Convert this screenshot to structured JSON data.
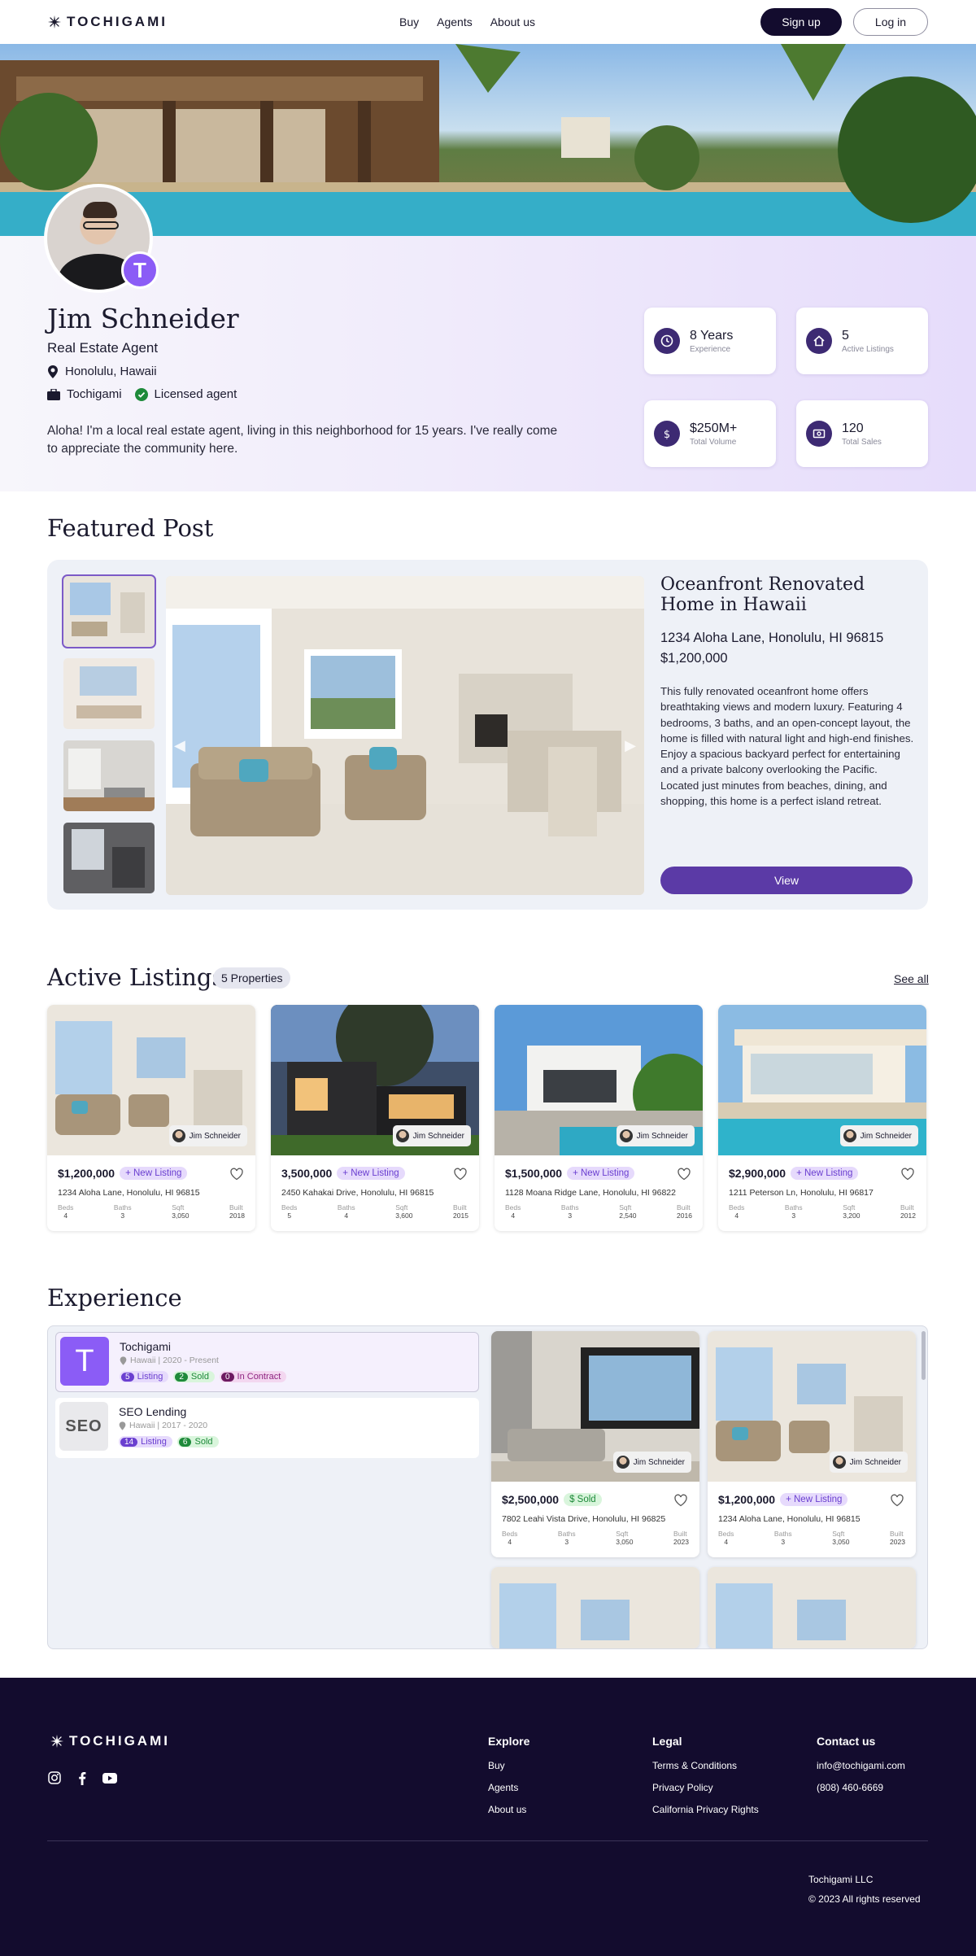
{
  "brand": {
    "name": "TOCHIGAMI"
  },
  "nav": {
    "links": [
      "Buy",
      "Agents",
      "About us"
    ],
    "signup": "Sign up",
    "login": "Log in"
  },
  "profile": {
    "name": "Jim Schneider",
    "role": "Real Estate Agent",
    "location": "Honolulu, Hawaii",
    "company": "Tochigami",
    "license": "Licensed agent",
    "bio": "Aloha! I'm a local real estate agent, living in this neighborhood for 15 years. I've really come to appreciate the community here.",
    "badge_letter": "T",
    "stats": [
      {
        "value": "8 Years",
        "label": "Experience",
        "icon": "clock-icon"
      },
      {
        "value": "5",
        "label": "Active Listings",
        "icon": "home-icon"
      },
      {
        "value": "$250M+",
        "label": "Total Volume",
        "icon": "dollar-icon"
      },
      {
        "value": "120",
        "label": "Total Sales",
        "icon": "cash-icon"
      }
    ]
  },
  "featured": {
    "heading": "Featured Post",
    "title": "Oceanfront Renovated Home in Hawaii",
    "address": "1234 Aloha Lane, Honolulu, HI 96815",
    "price": "$1,200,000",
    "description": "This fully renovated oceanfront home offers breathtaking views and modern luxury. Featuring 4 bedrooms, 3 baths, and an open-concept layout, the home is filled with natural light and high-end finishes. Enjoy a spacious backyard perfect for entertaining and a private balcony overlooking the Pacific. Located just minutes from beaches, dining, and shopping, this home is a perfect island retreat.",
    "view_label": "View"
  },
  "listings": {
    "heading": "Active Listings",
    "count": "5 Properties",
    "see_all": "See all",
    "spec_labels": {
      "beds": "Beds",
      "baths": "Baths",
      "sqft": "Sqft",
      "built": "Built"
    },
    "items": [
      {
        "price": "$1,200,000",
        "tag": "+ New Listing",
        "address": "1234 Aloha Lane, Honolulu, HI 96815",
        "beds": "4",
        "baths": "3",
        "sqft": "3,050",
        "built": "2018",
        "agent": "Jim Schneider"
      },
      {
        "price": "3,500,000",
        "tag": "+ New Listing",
        "address": "2450 Kahakai Drive, Honolulu, HI 96815",
        "beds": "5",
        "baths": "4",
        "sqft": "3,600",
        "built": "2015",
        "agent": "Jim Schneider"
      },
      {
        "price": "$1,500,000",
        "tag": "+ New Listing",
        "address": "1128 Moana Ridge Lane, Honolulu, HI 96822",
        "beds": "4",
        "baths": "3",
        "sqft": "2,540",
        "built": "2016",
        "agent": "Jim Schneider"
      },
      {
        "price": "$2,900,000",
        "tag": "+ New Listing",
        "address": "1211 Peterson Ln, Honolulu, HI 96817",
        "beds": "4",
        "baths": "3",
        "sqft": "3,200",
        "built": "2012",
        "agent": "Jim Schneider"
      }
    ]
  },
  "experience": {
    "heading": "Experience",
    "companies": [
      {
        "name": "Tochigami",
        "meta": "Hawaii | 2020 - Present",
        "listing": "5",
        "listing_label": "Listing",
        "sold": "2",
        "sold_label": "Sold",
        "contract": "0",
        "contract_label": "In Contract"
      },
      {
        "name": "SEO Lending",
        "logo_text": "SEO",
        "meta": "Hawaii | 2017 - 2020",
        "listing": "14",
        "listing_label": "Listing",
        "sold": "6",
        "sold_label": "Sold"
      }
    ],
    "cards": [
      {
        "price": "$2,500,000",
        "tag": "$ Sold",
        "address": "7802 Leahi Vista Drive, Honolulu, HI 96825",
        "beds": "4",
        "baths": "3",
        "sqft": "3,050",
        "built": "2023",
        "agent": "Jim Schneider"
      },
      {
        "price": "$1,200,000",
        "tag": "+ New Listing",
        "address": "1234 Aloha Lane, Honolulu, HI 96815",
        "beds": "4",
        "baths": "3",
        "sqft": "3,050",
        "built": "2023",
        "agent": "Jim Schneider"
      }
    ]
  },
  "footer": {
    "explore": {
      "title": "Explore",
      "links": [
        "Buy",
        "Agents",
        "About us"
      ]
    },
    "legal": {
      "title": "Legal",
      "links": [
        "Terms & Conditions",
        "Privacy Policy",
        "California Privacy Rights"
      ]
    },
    "contact": {
      "title": "Contact us",
      "email": "info@tochigami.com",
      "phone": "(808) 460-6669"
    },
    "company": "Tochigami LLC",
    "copyright": "© 2023 All rights reserved"
  }
}
